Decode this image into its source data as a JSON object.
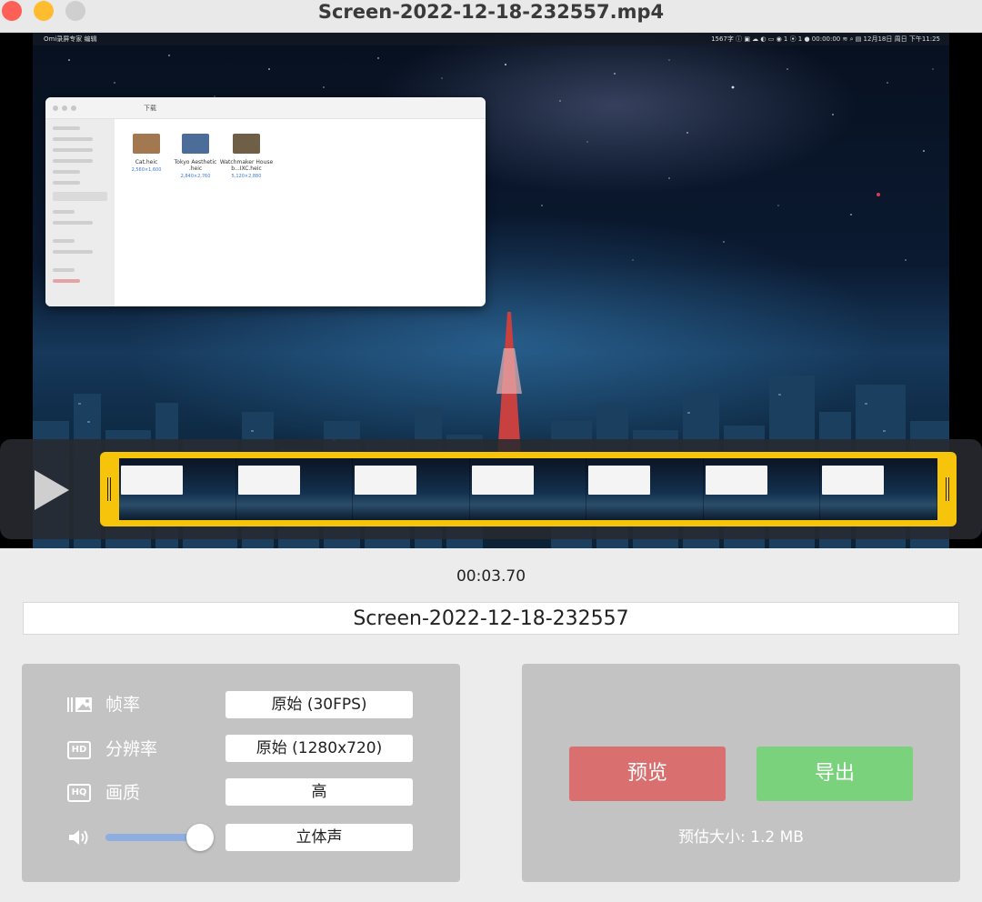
{
  "window": {
    "title": "Screen-2022-12-18-232557.mp4"
  },
  "video": {
    "menubar": {
      "left": "  Omi录屏专家   编辑",
      "right": "1567字  ⓘ  ▣  ☁  ◐  ▭  ◉  1  ⦿ 1   ● 00:00:00   ≋  ⌕  ▤  12月18日 周日 下午11:25"
    },
    "finder": {
      "title": "下载",
      "files": [
        {
          "name": "Cat.heic",
          "dims": "2,560×1,600"
        },
        {
          "name": "Tokyo Aesthetic .heic",
          "dims": "2,840×2,760"
        },
        {
          "name": "Watchmaker House b...IXC.heic",
          "dims": "5,120×2,880"
        }
      ]
    }
  },
  "player": {
    "frame_count": 7
  },
  "timecode": "00:03.70",
  "filename": "Screen-2022-12-18-232557",
  "settings": {
    "framerate": {
      "label": "帧率",
      "value": "原始 (30FPS)"
    },
    "resolution": {
      "label": "分辨率",
      "value": "原始 (1280x720)"
    },
    "quality": {
      "label": "画质",
      "value": "高"
    },
    "audio": {
      "value": "立体声",
      "volume_fraction": 1.0
    }
  },
  "actions": {
    "preview_label": "预览",
    "export_label": "导出",
    "estimate": "预估大小: 1.2 MB"
  },
  "colors": {
    "preview": "#d9706f",
    "export": "#7bd27c",
    "trim_frame": "#f6c40a"
  }
}
